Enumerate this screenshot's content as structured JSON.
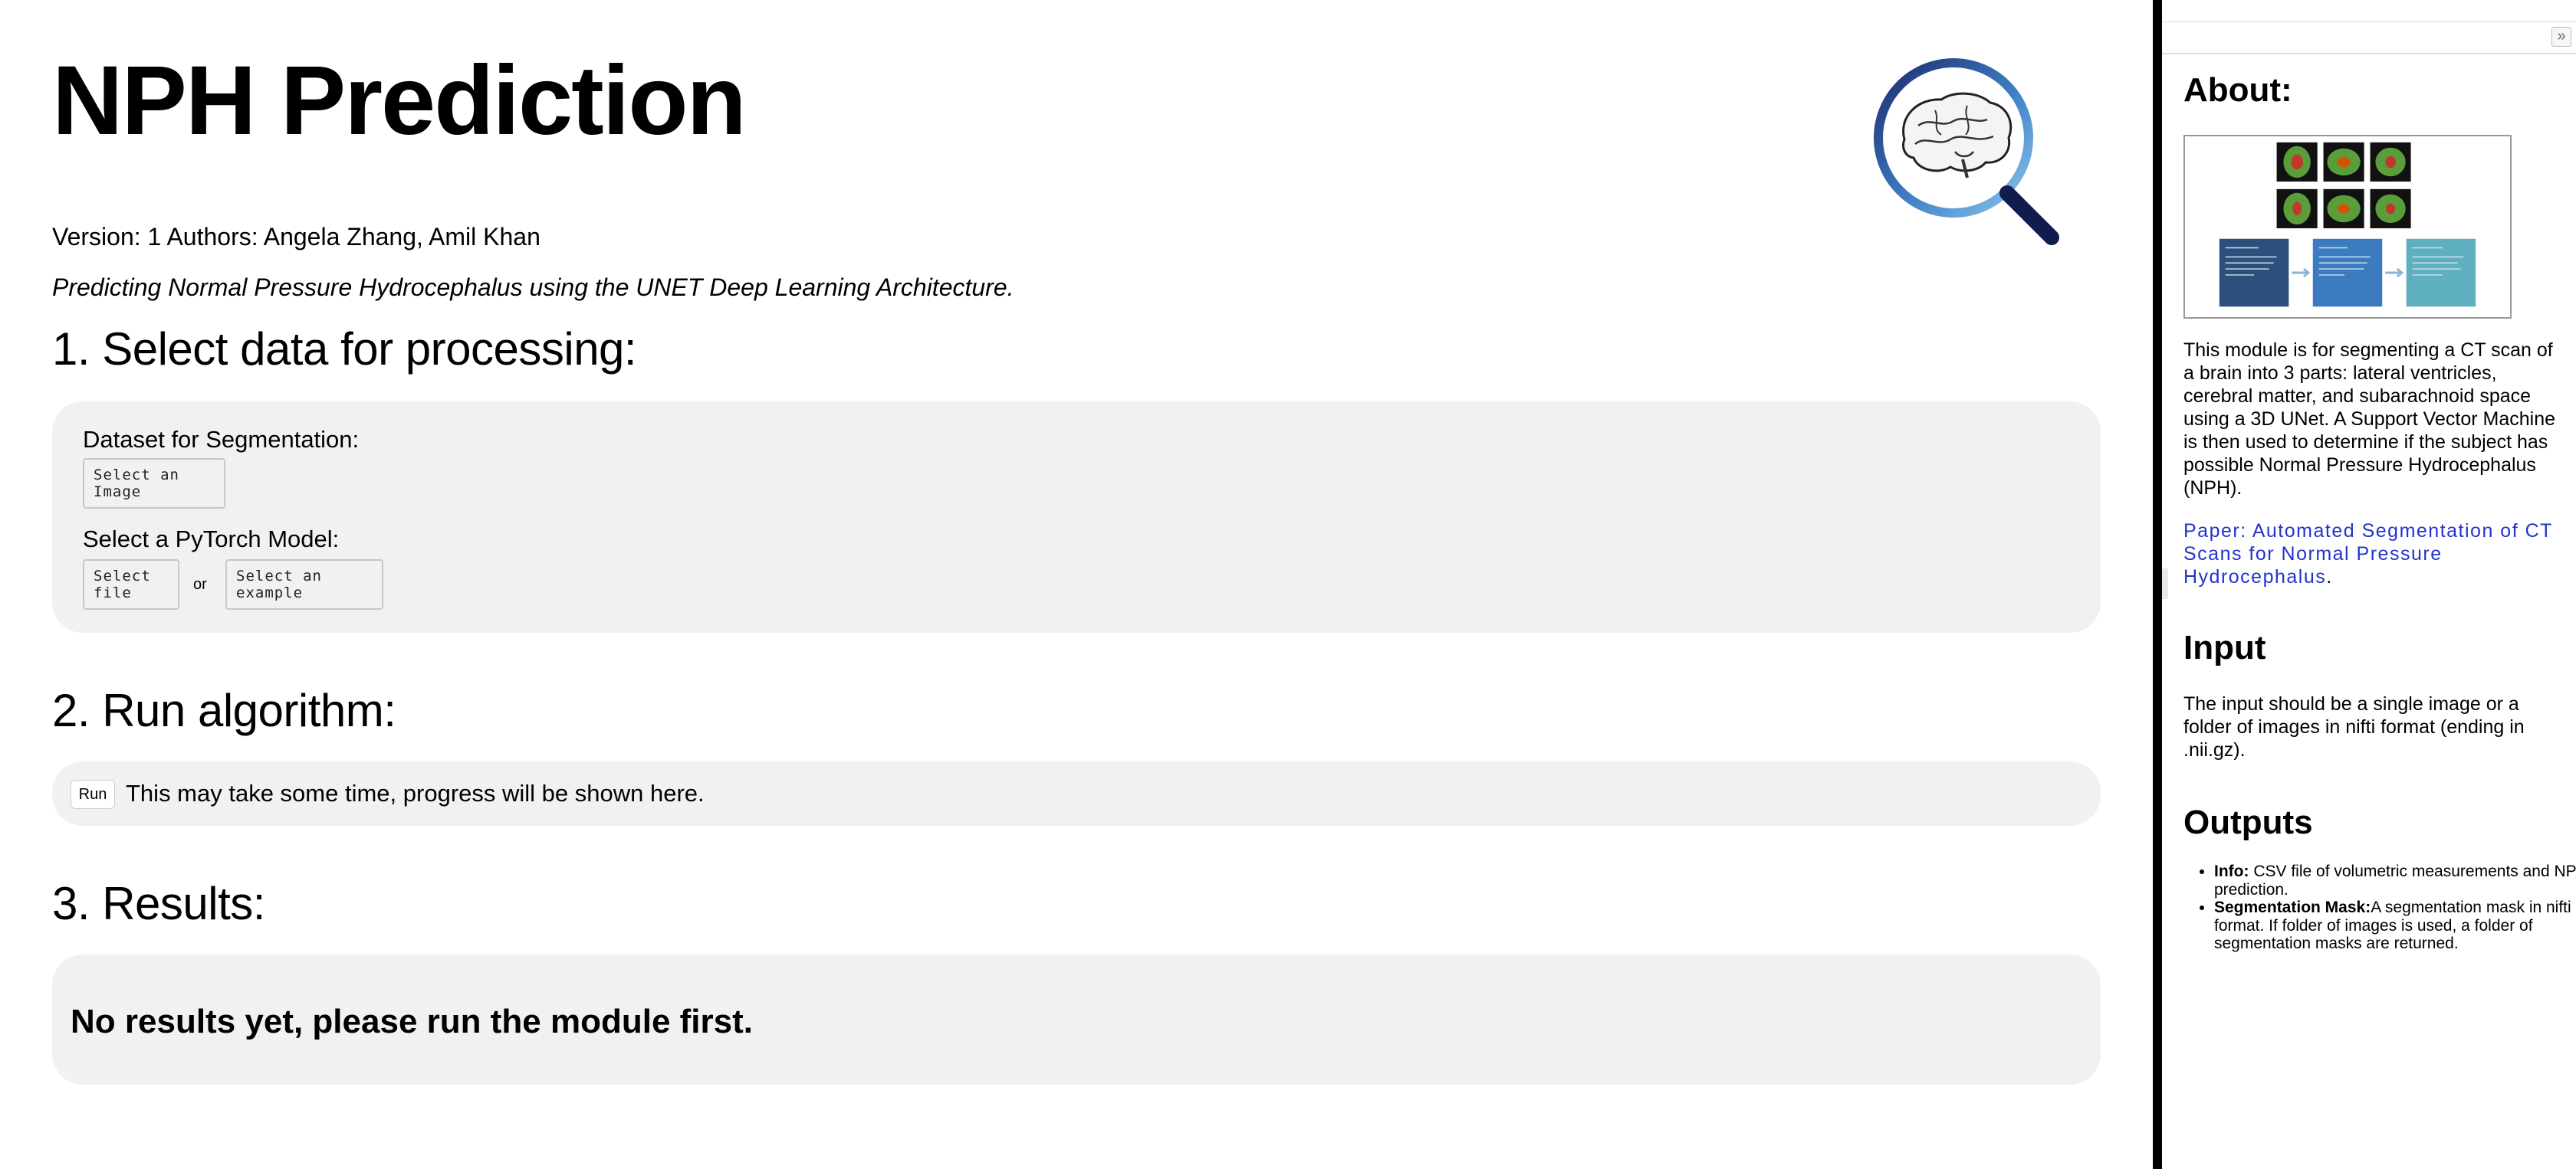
{
  "header": {
    "title": "NPH Prediction",
    "meta": "Version: 1 Authors: Angela Zhang, Amil Khan",
    "tagline": "Predicting Normal Pressure Hydrocephalus using the UNET Deep Learning Architecture."
  },
  "section1": {
    "heading": "1. Select data for processing:",
    "dataset_label": "Dataset for Segmentation:",
    "select_image_button": "Select an Image",
    "model_label": "Select a PyTorch Model:",
    "select_file_button": "Select file",
    "or_label": "or",
    "select_example_button": "Select an example"
  },
  "section2": {
    "heading": "2. Run algorithm:",
    "run_button": "Run",
    "status": "This may take some time, progress will be shown here."
  },
  "section3": {
    "heading": "3. Results:",
    "empty_message": "No results yet, please run the module first."
  },
  "sidebar": {
    "collapse_icon": "»",
    "about_heading": "About:",
    "about_text": "This module is for segmenting a CT scan of a brain into 3 parts: lateral ventricles, cerebral matter, and subarachnoid space using a 3D UNet. A Support Vector Machine is then used to determine if the subject has possible Normal Pressure Hydrocephalus (NPH).",
    "paper_link": "Paper: Automated Segmentation of CT Scans for Normal Pressure Hydrocephalus",
    "paper_link_suffix": ".",
    "input_heading": "Input",
    "input_text": "The input should be a single image or a folder of images in nifti format (ending in .nii.gz).",
    "outputs_heading": "Outputs",
    "outputs": [
      {
        "term": "Info:",
        "desc": " CSV file of volumetric measurements and NPH prediction."
      },
      {
        "term": "Segmentation Mask:",
        "desc": "A segmentation mask in nifti format. If folder of images is used, a folder of segmentation masks are returned."
      }
    ]
  },
  "colors": {
    "card_bg": "#f1f1f1",
    "link": "#2233cc",
    "logo_ring_dark": "#1b2a6b",
    "logo_ring_light": "#6fb6e8"
  },
  "icons": {
    "logo": "brain-magnifier-icon",
    "collapse": "double-chevron-right-icon"
  }
}
